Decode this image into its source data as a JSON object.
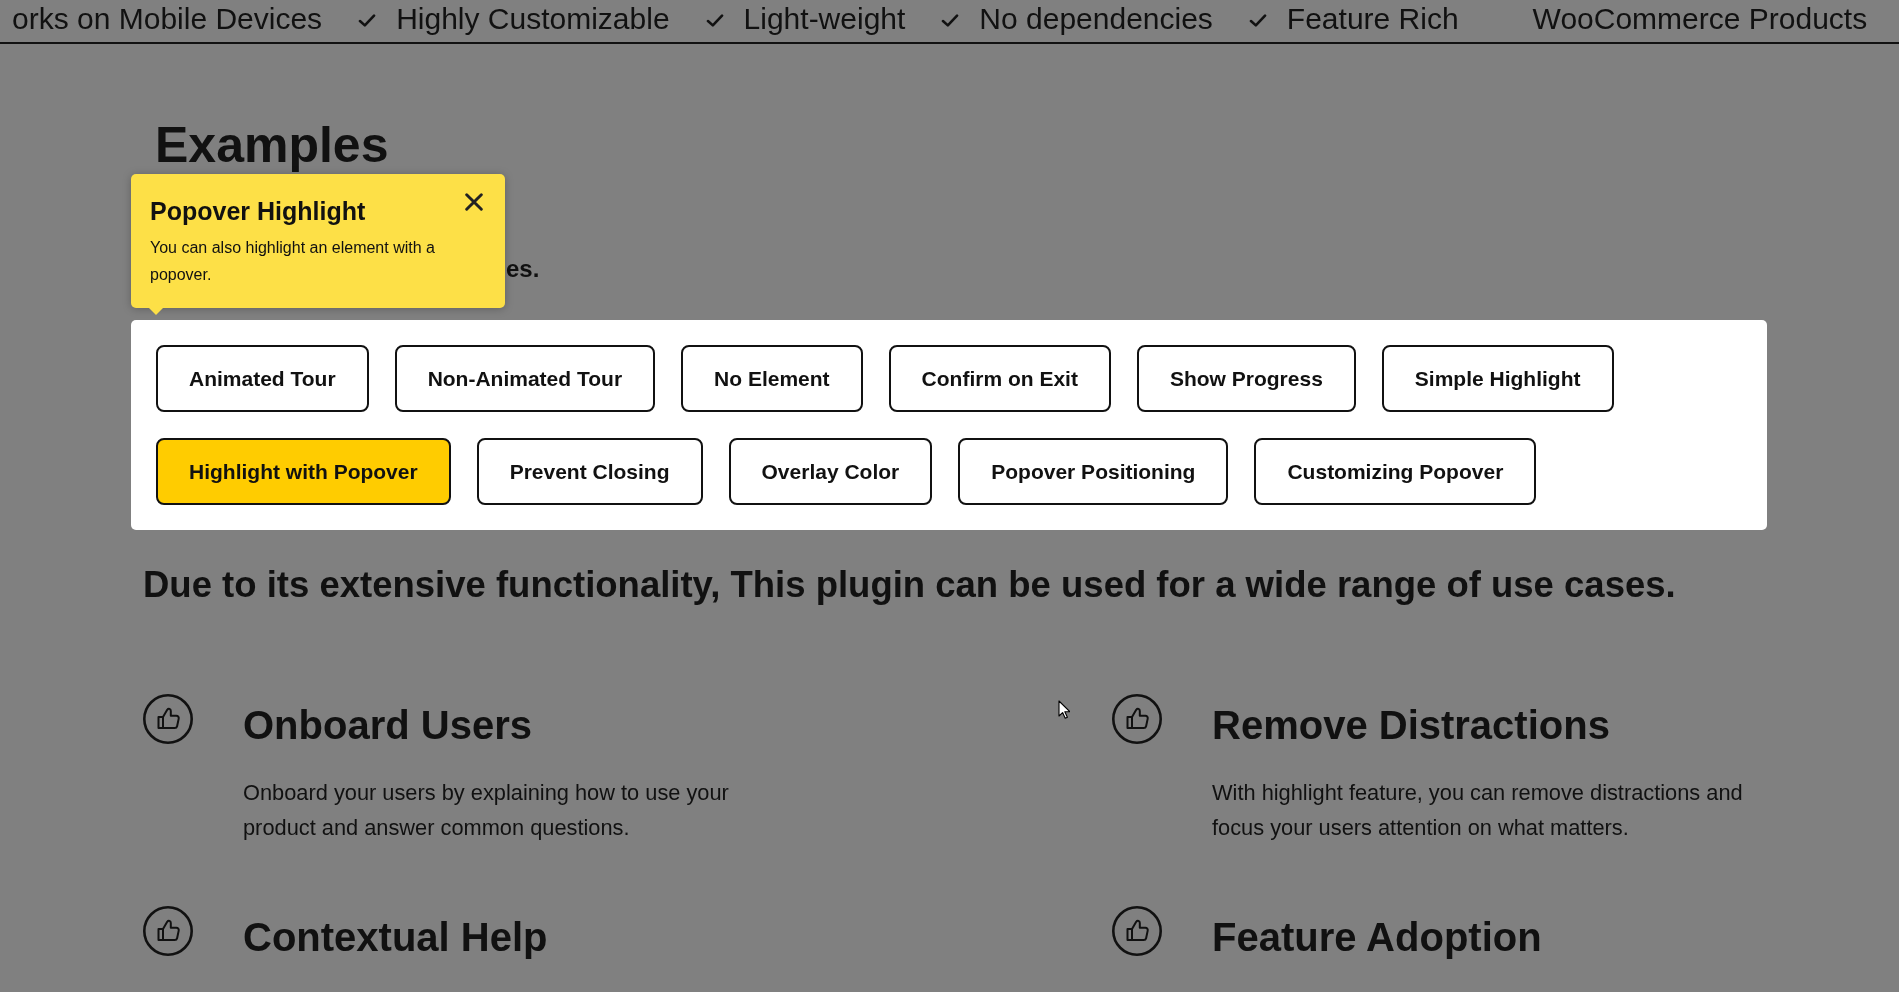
{
  "ticker": {
    "items": [
      {
        "text": "orks on Mobile Devices",
        "bullet": false
      },
      {
        "text": "Highly Customizable",
        "bullet": true
      },
      {
        "text": "Light-weight",
        "bullet": true
      },
      {
        "text": "No dependencies",
        "bullet": true
      },
      {
        "text": "Feature Rich",
        "bullet": true
      },
      {
        "text": "WooCommerce Products",
        "bullet": false
      }
    ]
  },
  "examples": {
    "title": "Examples",
    "subtitle": "es.",
    "buttons": [
      {
        "label": "Animated Tour",
        "selected": false
      },
      {
        "label": "Non-Animated Tour",
        "selected": false
      },
      {
        "label": "No Element",
        "selected": false
      },
      {
        "label": "Confirm on Exit",
        "selected": false
      },
      {
        "label": "Show Progress",
        "selected": false
      },
      {
        "label": "Simple Highlight",
        "selected": false
      },
      {
        "label": "Highlight with Popover",
        "selected": true
      },
      {
        "label": "Prevent Closing",
        "selected": false
      },
      {
        "label": "Overlay Color",
        "selected": false
      },
      {
        "label": "Popover Positioning",
        "selected": false
      },
      {
        "label": "Customizing Popover",
        "selected": false
      }
    ]
  },
  "popover": {
    "title": "Popover Highlight",
    "body": "You can also highlight an element with a popover."
  },
  "use_cases": {
    "heading": "Due to its extensive functionality, This plugin can be used for a wide range of use cases.",
    "features": [
      {
        "title": "Onboard Users",
        "description": "Onboard your users by explaining how to use your product and answer common questions."
      },
      {
        "title": "Remove Distractions",
        "description": "With highlight feature, you can remove distractions and focus your users attention on what matters."
      },
      {
        "title": "Contextual Help"
      },
      {
        "title": "Feature Adoption"
      }
    ]
  }
}
